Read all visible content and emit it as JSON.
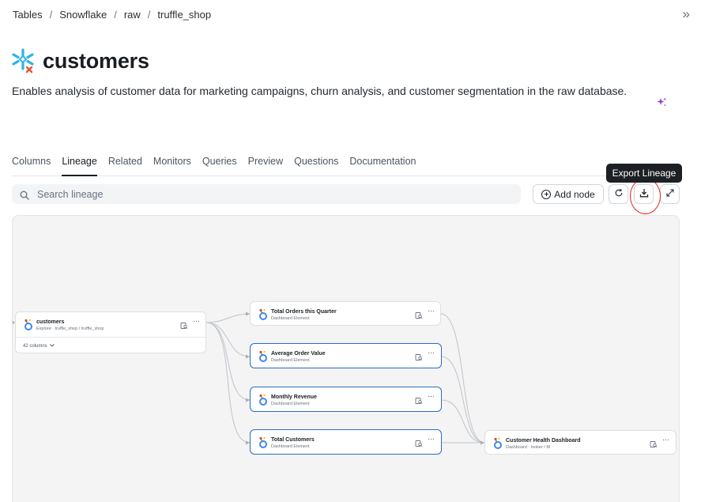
{
  "breadcrumb": {
    "items": [
      "Tables",
      "Snowflake",
      "raw",
      "truffle_shop"
    ],
    "separator": "/"
  },
  "header": {
    "title": "customers",
    "description": "Enables analysis of customer data for marketing campaigns, churn analysis, and customer segmentation in the raw database.",
    "collapse_glyph": "»"
  },
  "tabs": [
    {
      "label": "Columns",
      "active": false
    },
    {
      "label": "Lineage",
      "active": true
    },
    {
      "label": "Related",
      "active": false
    },
    {
      "label": "Monitors",
      "active": false
    },
    {
      "label": "Queries",
      "active": false
    },
    {
      "label": "Preview",
      "active": false
    },
    {
      "label": "Questions",
      "active": false
    },
    {
      "label": "Documentation",
      "active": false
    }
  ],
  "toolbar": {
    "search_placeholder": "Search lineage",
    "add_node_label": "Add node",
    "tooltip": "Export Lineage"
  },
  "lineage": {
    "source": {
      "title": "customers",
      "subtitle": "Explore · truffle_shop / truffle_shop",
      "columns_label": "42 columns"
    },
    "elements": [
      {
        "title": "Total Orders this Quarter",
        "subtitle": "Dashboard Element",
        "selected": false
      },
      {
        "title": "Average Order Value",
        "subtitle": "Dashboard Element",
        "selected": true
      },
      {
        "title": "Monthly Revenue",
        "subtitle": "Dashboard Element",
        "selected": true
      },
      {
        "title": "Total Customers",
        "subtitle": "Dashboard Element",
        "selected": true
      }
    ],
    "target": {
      "title": "Customer Health Dashboard",
      "subtitle": "Dashboard · looker / BI"
    },
    "more_glyph": "···"
  },
  "colors": {
    "snowflake": "#29b5e8",
    "error_badge": "#e5533d",
    "selected_border": "#2a6cc8",
    "highlight_ring": "#e5261f",
    "sparkle": "#8b3fd1"
  },
  "icons": {
    "header_logo": "snowflake-icon",
    "node_logo": "looker-icon",
    "refresh": "refresh-icon",
    "export": "download-icon",
    "expand": "expand-icon",
    "search": "search-icon",
    "add": "plus-circle-icon",
    "ai": "sparkle-icon"
  }
}
